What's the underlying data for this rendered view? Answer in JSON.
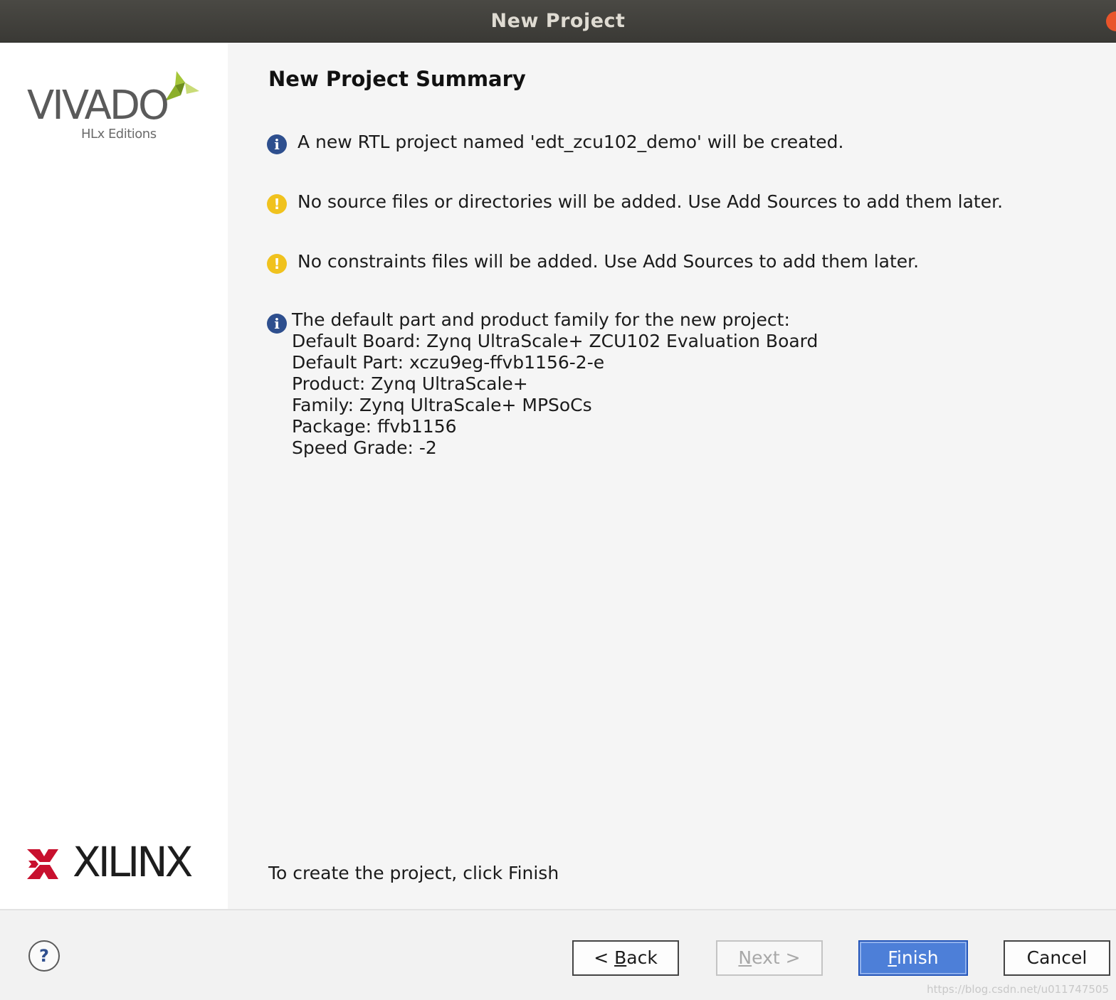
{
  "window": {
    "title": "New Project"
  },
  "sidebar": {
    "vivado_logo": {
      "word": "VIVADO",
      "subtitle": "HLx Editions",
      "mark_colors": [
        "#a5c638",
        "#6e8f1d",
        "#c9db77"
      ]
    },
    "xilinx_logo": {
      "word": "XILINX",
      "mark_color": "#c8102e"
    }
  },
  "main": {
    "page_title": "New Project Summary",
    "messages": [
      {
        "type": "info",
        "icon": "info-icon",
        "text": "A new RTL project named 'edt_zcu102_demo' will be created."
      },
      {
        "type": "warning",
        "icon": "warning-icon",
        "text": "No source files or directories will be added. Use Add Sources to add them later."
      },
      {
        "type": "warning",
        "icon": "warning-icon",
        "text": "No constraints files will be added. Use Add Sources to add them later."
      }
    ],
    "defaults": {
      "icon": "info-icon",
      "lines": [
        "The default part and product family for the new project:",
        "Default Board: Zynq UltraScale+ ZCU102 Evaluation Board",
        "Default Part: xczu9eg-ffvb1156-2-e",
        "Product: Zynq UltraScale+",
        "Family: Zynq UltraScale+ MPSoCs",
        "Package: ffvb1156",
        "Speed Grade: -2"
      ]
    },
    "finish_hint": "To create the project, click Finish"
  },
  "footer": {
    "help_label": "?",
    "buttons": {
      "back": {
        "prefix": "< ",
        "mnemonic": "B",
        "rest": "ack"
      },
      "next": {
        "mnemonic": "N",
        "rest": "ext >"
      },
      "finish": {
        "mnemonic": "F",
        "rest": "inish"
      },
      "cancel": "Cancel"
    }
  },
  "colors": {
    "titlebar": "#3f3e3a",
    "info_icon": "#2e4f8e",
    "warning_icon": "#f0c21e",
    "primary_button": "#4d7fd8"
  },
  "watermark": "https://blog.csdn.net/u011747505"
}
